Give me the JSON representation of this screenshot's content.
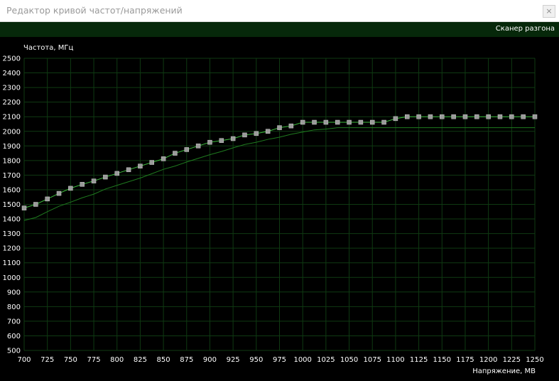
{
  "window": {
    "title": "Редактор кривой частот/напряжений",
    "close_label": "×"
  },
  "toolbar": {
    "scanner_label": "Сканер разгона"
  },
  "chart_data": {
    "type": "line",
    "ylabel": "Частота, МГц",
    "xlabel": "Напряжение, МВ",
    "xlim": [
      700,
      1250
    ],
    "ylim": [
      500,
      2500
    ],
    "x_ticks": [
      700,
      725,
      750,
      775,
      800,
      825,
      850,
      875,
      900,
      925,
      950,
      975,
      1000,
      1025,
      1050,
      1075,
      1100,
      1125,
      1150,
      1175,
      1200,
      1225,
      1250
    ],
    "y_ticks": [
      500,
      600,
      700,
      800,
      900,
      1000,
      1100,
      1200,
      1300,
      1400,
      1500,
      1600,
      1700,
      1800,
      1900,
      2000,
      2100,
      2200,
      2300,
      2400,
      2500
    ],
    "grid": true,
    "colors": {
      "grid": "#0f3a12",
      "curve": "#3cb83c",
      "base_curve": "#1f7a1f",
      "point_fill": "#9a9a9a",
      "axis_text": "#ffffff"
    },
    "series": [
      {
        "role": "editable-curve",
        "x": [
          700,
          712.5,
          725,
          737.5,
          750,
          762.5,
          775,
          787.5,
          800,
          812.5,
          825,
          837.5,
          850,
          862.5,
          875,
          887.5,
          900,
          912.5,
          925,
          937.5,
          950,
          962.5,
          975,
          987.5,
          1000,
          1012.5,
          1025,
          1037.5,
          1050,
          1062.5,
          1075,
          1087.5,
          1100,
          1112.5,
          1125,
          1137.5,
          1150,
          1162.5,
          1175,
          1187.5,
          1200,
          1212.5,
          1225,
          1237.5,
          1250
        ],
        "values": [
          1475,
          1500,
          1537,
          1575,
          1610,
          1637,
          1660,
          1687,
          1712,
          1737,
          1762,
          1787,
          1812,
          1850,
          1875,
          1900,
          1925,
          1937,
          1950,
          1975,
          1985,
          2000,
          2025,
          2037,
          2062,
          2062,
          2062,
          2062,
          2062,
          2062,
          2062,
          2062,
          2087,
          2100,
          2100,
          2100,
          2100,
          2100,
          2100,
          2100,
          2100,
          2100,
          2100,
          2100,
          2100
        ]
      },
      {
        "role": "base-curve",
        "x": [
          700,
          712.5,
          725,
          737.5,
          750,
          762.5,
          775,
          787.5,
          800,
          812.5,
          825,
          837.5,
          850,
          862.5,
          875,
          887.5,
          900,
          912.5,
          925,
          937.5,
          950,
          962.5,
          975,
          987.5,
          1000,
          1012.5,
          1025,
          1037.5,
          1050,
          1062.5,
          1075,
          1087.5,
          1100,
          1112.5,
          1125,
          1137.5,
          1150,
          1162.5,
          1175,
          1187.5,
          1200,
          1212.5,
          1225,
          1237.5,
          1250
        ],
        "values": [
          1390,
          1410,
          1450,
          1487,
          1515,
          1545,
          1570,
          1605,
          1630,
          1655,
          1680,
          1710,
          1740,
          1762,
          1790,
          1815,
          1840,
          1862,
          1887,
          1910,
          1925,
          1945,
          1960,
          1980,
          1995,
          2010,
          2015,
          2025,
          2025,
          2025,
          2025,
          2025,
          2025,
          2025,
          2025,
          2025,
          2025,
          2025,
          2025,
          2025,
          2025,
          2025,
          2025,
          2025,
          2025
        ]
      }
    ]
  }
}
